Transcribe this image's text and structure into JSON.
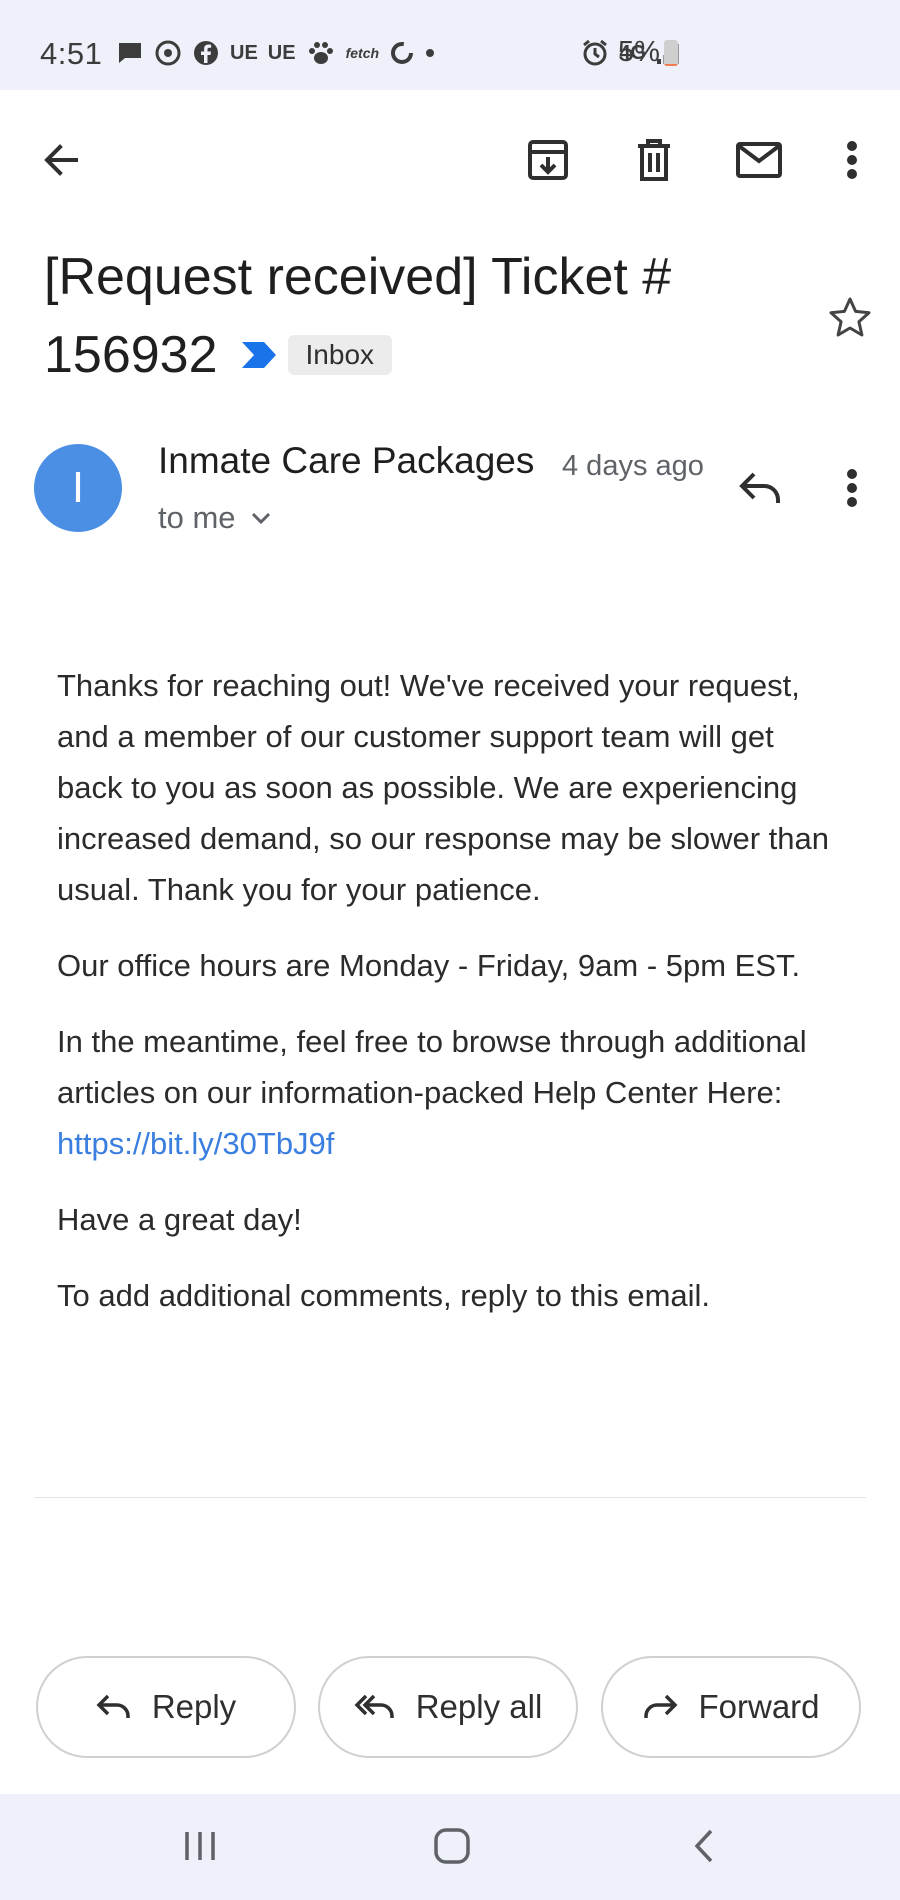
{
  "status_bar": {
    "time": "4:51",
    "left_icons": [
      "message-icon",
      "messenger-icon",
      "facebook-icon",
      "ue-icon",
      "ue-icon",
      "paw-icon",
      "fetch-icon",
      "sync-icon",
      "dot-icon"
    ],
    "ue_label_1": "UE",
    "ue_label_2": "UE",
    "fetch_label": "fetch",
    "network_label": "4G",
    "battery_percent": "5%",
    "battery_level": 0.05,
    "battery_color": "#f47a50"
  },
  "toolbar": {
    "icons": [
      "back-arrow-icon",
      "archive-icon",
      "delete-icon",
      "mark-unread-icon",
      "more-vert-icon"
    ]
  },
  "email": {
    "subject_line1": "[Request received] Ticket #",
    "subject_line2": "156932",
    "label": "Inbox",
    "importance_color": "#1a73e8",
    "starred": false,
    "sender": {
      "initial": "I",
      "name": "Inmate Care Packages",
      "time": "4 days ago",
      "recipient": "to me",
      "avatar_color": "#4a8fe4"
    },
    "body": {
      "p1": "Thanks for reaching out! We've received your request, and a member of our customer support team will get back to you as soon as possible. We are experiencing increased demand, so our response may be slower than usual. Thank you for your patience.",
      "p2": "Our office hours are Monday - Friday, 9am - 5pm EST.",
      "p3_text": "In the meantime, feel free to browse through additional articles on our information-packed Help Center Here:",
      "p3_link": "https://bit.ly/30TbJ9f",
      "p4": "Have a great day!",
      "p5": "To add additional comments, reply to this email."
    },
    "link_color": "#3a7ee0"
  },
  "actions": {
    "reply": "Reply",
    "reply_all": "Reply all",
    "forward": "Forward"
  },
  "nav_bar": {
    "icons": [
      "recent-apps-icon",
      "home-icon",
      "back-icon"
    ]
  }
}
